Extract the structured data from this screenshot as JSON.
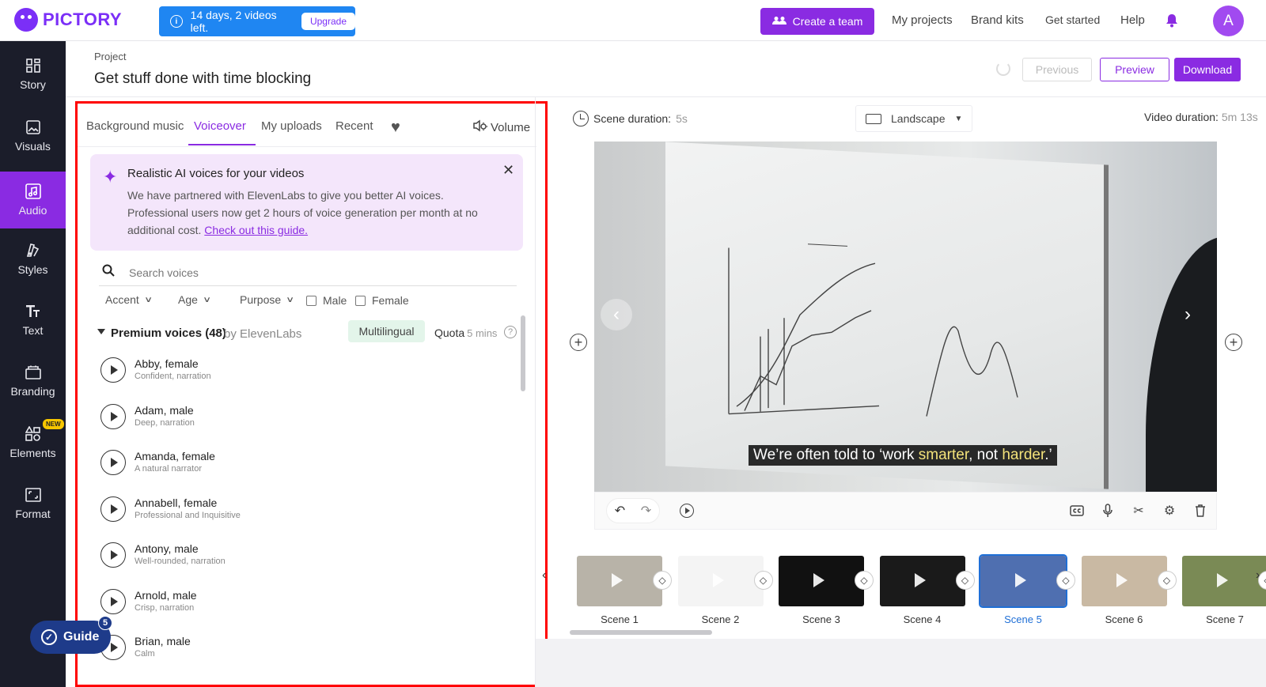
{
  "header": {
    "brand": "PICTORY",
    "trial_text": "14 days, 2 videos left.",
    "upgrade_label": "Upgrade",
    "create_team_label": "Create a team",
    "nav": [
      "My projects",
      "Brand kits",
      "Get started",
      "Help"
    ],
    "avatar_initial": "A",
    "icons": [
      "octopus-logo-icon",
      "info-icon",
      "team-icon",
      "bell-icon"
    ]
  },
  "sidebar": {
    "items": [
      {
        "label": "Story",
        "icon": "grid-icon"
      },
      {
        "label": "Visuals",
        "icon": "image-icon"
      },
      {
        "label": "Audio",
        "icon": "music-icon",
        "active": true
      },
      {
        "label": "Styles",
        "icon": "palette-icon"
      },
      {
        "label": "Text",
        "icon": "text-icon"
      },
      {
        "label": "Branding",
        "icon": "briefcase-icon"
      },
      {
        "label": "Elements",
        "icon": "shapes-icon",
        "badge": "NEW"
      },
      {
        "label": "Format",
        "icon": "frame-icon"
      }
    ],
    "guide": {
      "label": "Guide",
      "count": "5"
    }
  },
  "project": {
    "label": "Project",
    "title": "Get stuff done with time blocking",
    "buttons": {
      "previous": "Previous",
      "preview": "Preview",
      "download": "Download"
    }
  },
  "audio_panel": {
    "tabs": [
      "Background music",
      "Voiceover",
      "My uploads",
      "Recent"
    ],
    "active_tab": "Voiceover",
    "volume_label": "Volume",
    "promo": {
      "title": "Realistic AI voices for your videos",
      "body": "We have partnered with ElevenLabs to give you better AI voices. Professional users now get 2 hours of voice generation per month at no additional cost. ",
      "link": "Check out this guide."
    },
    "search_placeholder": "Search voices",
    "filters": {
      "accent": "Accent",
      "age": "Age",
      "purpose": "Purpose",
      "male": "Male",
      "female": "Female"
    },
    "premium": {
      "title": "Premium voices (48)",
      "by": "by ElevenLabs",
      "multilingual": "Multilingual",
      "quota_label": "Quota",
      "quota_value": "5 mins"
    },
    "voices": [
      {
        "name": "Abby, female",
        "desc": "Confident, narration"
      },
      {
        "name": "Adam, male",
        "desc": "Deep, narration"
      },
      {
        "name": "Amanda, female",
        "desc": "A natural narrator"
      },
      {
        "name": "Annabell, female",
        "desc": "Professional and Inquisitive"
      },
      {
        "name": "Antony, male",
        "desc": "Well-rounded, narration"
      },
      {
        "name": "Arnold, male",
        "desc": "Crisp, narration"
      },
      {
        "name": "Brian, male",
        "desc": "Calm"
      }
    ]
  },
  "editor": {
    "scene_duration_label": "Scene duration:",
    "scene_duration_value": "5s",
    "orientation": "Landscape",
    "video_duration_label": "Video duration:",
    "video_duration_value": "5m 13s",
    "caption_parts": [
      "We’re often told to ‘work ",
      "smarter",
      ", not ",
      "harder",
      ".’"
    ],
    "control_icons": [
      "undo-icon",
      "redo-icon",
      "play-icon",
      "captions-icon",
      "mic-icon",
      "scissors-icon",
      "settings-icon",
      "trash-icon"
    ]
  },
  "timeline": {
    "active_scene": "Scene 5",
    "scenes": [
      {
        "label": "Scene 1",
        "color": "#b8b3a8"
      },
      {
        "label": "Scene 2",
        "color": "#f4f4f4"
      },
      {
        "label": "Scene 3",
        "color": "#111111"
      },
      {
        "label": "Scene 4",
        "color": "#1a1a1a"
      },
      {
        "label": "Scene 5",
        "color": "#4f6fb0"
      },
      {
        "label": "Scene 6",
        "color": "#c9b9a3"
      },
      {
        "label": "Scene 7",
        "color": "#7a8a55"
      }
    ]
  },
  "colors": {
    "brand": "#8a2be2",
    "trial_banner": "#1f86f2",
    "sidebar_bg": "#1b1d2a",
    "highlight_box": "#ff0000"
  }
}
